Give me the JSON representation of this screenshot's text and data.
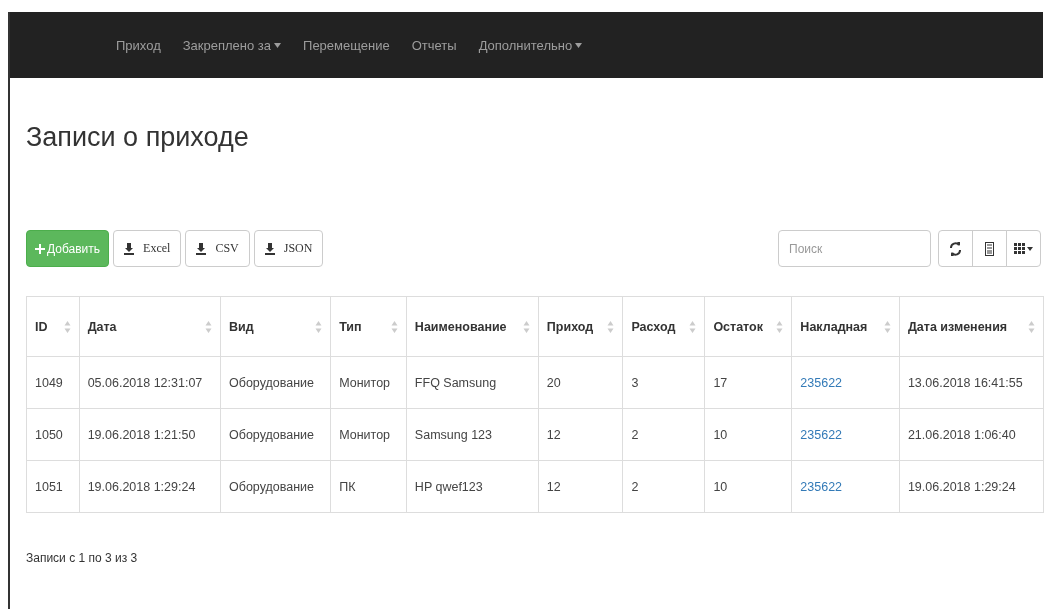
{
  "navbar": {
    "items": [
      {
        "label": "Приход",
        "dropdown": false
      },
      {
        "label": "Закреплено за",
        "dropdown": true
      },
      {
        "label": "Перемещение",
        "dropdown": false
      },
      {
        "label": "Отчеты",
        "dropdown": false
      },
      {
        "label": "Дополнительно",
        "dropdown": true
      }
    ]
  },
  "page_title": "Записи о приходе",
  "toolbar": {
    "add_button": "Добавить",
    "export_buttons": [
      "Excel",
      "CSV",
      "JSON"
    ],
    "search": {
      "placeholder": "Поиск"
    }
  },
  "table": {
    "columns": [
      "ID",
      "Дата",
      "Вид",
      "Тип",
      "Наименование",
      "Приход",
      "Расход",
      "Остаток",
      "Накладная",
      "Дата изменения"
    ],
    "rows": [
      [
        "1049",
        "05.06.2018 12:31:07",
        "Оборудование",
        "Монитор",
        "FFQ Samsung",
        "20",
        "3",
        "17",
        "235622",
        "13.06.2018 16:41:55"
      ],
      [
        "1050",
        "19.06.2018 1:21:50",
        "Оборудование",
        "Монитор",
        "Samsung 123",
        "12",
        "2",
        "10",
        "235622",
        "21.06.2018 1:06:40"
      ],
      [
        "1051",
        "19.06.2018 1:29:24",
        "Оборудование",
        "ПК",
        "HP qwef123",
        "12",
        "2",
        "10",
        "235622",
        "19.06.2018 1:29:24"
      ]
    ]
  },
  "pagination_info": "Записи с 1 по 3 из 3"
}
